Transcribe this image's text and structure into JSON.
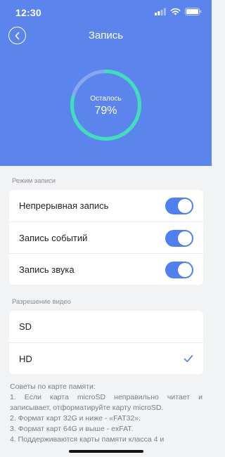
{
  "status_bar": {
    "time": "12:30"
  },
  "header": {
    "title": "Запись",
    "color": "#5b85ec"
  },
  "storage": {
    "label": "Осталось",
    "value_text": "79%",
    "remaining_fraction": 0.79,
    "ring_color": "#3fe0b8"
  },
  "recording_mode": {
    "header": "Режим записи",
    "items": [
      {
        "label": "Непрерывная запись",
        "enabled": true
      },
      {
        "label": "Запись событий",
        "enabled": true
      },
      {
        "label": "Запись звука",
        "enabled": true
      }
    ]
  },
  "video_resolution": {
    "header": "Разрешение видео",
    "options": [
      {
        "label": "SD",
        "selected": false
      },
      {
        "label": "HD",
        "selected": true
      }
    ]
  },
  "tips": {
    "title": "Советы по карте памяти:",
    "lines": [
      "1. Если карта microSD неправильно читает и записывает, отформатируйте карту microSD.",
      "2. Формат карт 32G и ниже - «FAT32».",
      "3. Формат карт 64G и выше - exFAT.",
      "4. Поддерживаются карты памяти класса 4 и"
    ]
  },
  "colors": {
    "accent": "#4f7ff0",
    "background": "#f2f3f5"
  }
}
